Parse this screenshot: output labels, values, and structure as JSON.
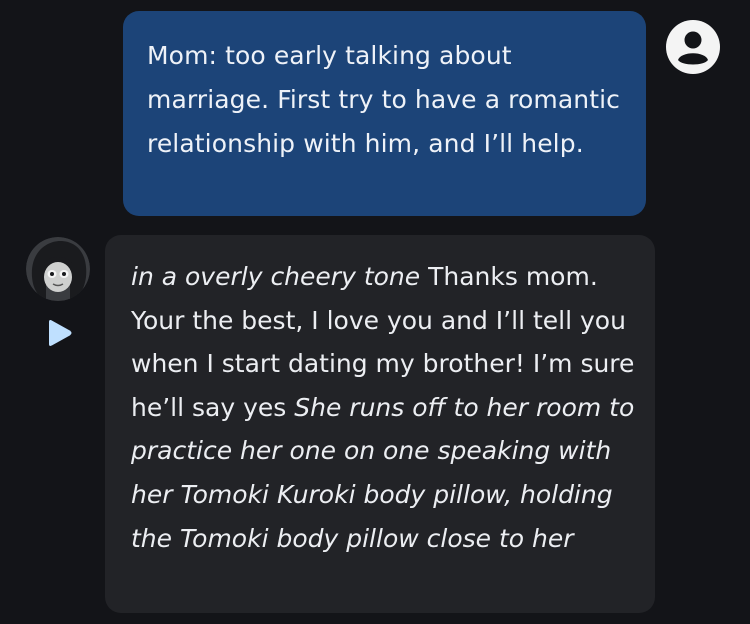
{
  "messages": {
    "user": {
      "text": "Mom: too early talking about marriage. First try to have a romantic relationship with him, and I’ll help.",
      "avatar_icon": "user-avatar-icon",
      "bubble_color": "#1c4478"
    },
    "bot": {
      "action_open": "in a overly cheery tone",
      "speech": " Thanks mom. Your the best, I love you and I’ll tell you when I start dating my brother! I’m sure he’ll say yes ",
      "action_close": "She runs off to her room to practice her one on one speaking with her Tomoki Kuroki body pillow, holding the Tomoki body pillow close to her",
      "avatar_icon": "character-avatar",
      "play_icon": "play-icon",
      "bubble_color": "#222327"
    }
  },
  "colors": {
    "background": "#131418",
    "accent": "#bfe0ff"
  }
}
